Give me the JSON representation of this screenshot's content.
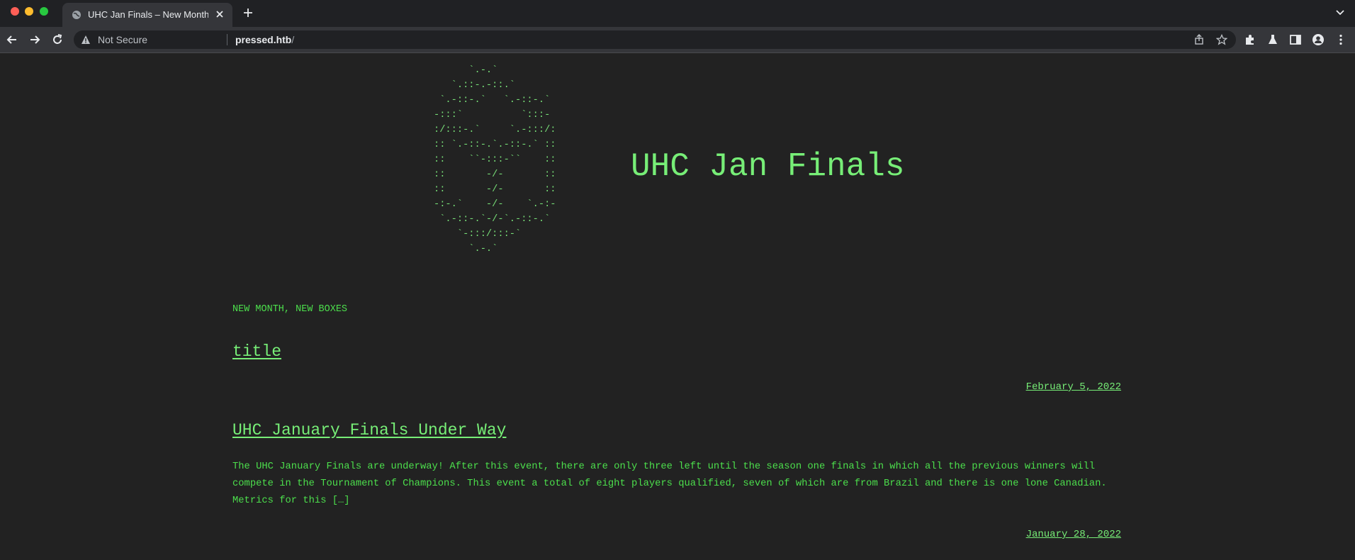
{
  "browser": {
    "tab_title": "UHC Jan Finals – New Month, New Boxes",
    "security_label": "Not Secure",
    "url_host": "pressed.htb",
    "url_path": "/"
  },
  "site": {
    "ascii_logo": "      `.-.`\n   `.::-.-::.`\n `.-::-.`   `.-::-.`\n-:::`          `:::-\n:/:::-.`     `.-:::/:\n:: `.-::-.`.-::-.` ::\n::    ``-:::-``    ::\n::       -/-       ::\n::       -/-       ::\n-:-.`    -/-    `.-:-\n `.-::-.`-/-`.-::-.`\n    `-:::/:::-`\n      `.-.`",
    "title": "UHC Jan Finals",
    "tagline": "NEW MONTH, NEW BOXES"
  },
  "posts": [
    {
      "title": "title",
      "date": "February 5, 2022",
      "excerpt": ""
    },
    {
      "title": "UHC January Finals Under Way",
      "excerpt": "The UHC January Finals are underway! After this event, there are only three left until the season one finals in which all the previous winners will compete in the Tournament of Champions. This event a total of eight players qualified, seven of which are from Brazil and there is one lone Canadian. Metrics for this […]",
      "date": "January 28, 2022"
    }
  ],
  "colors": {
    "page_bg": "#222222",
    "text_green": "#77ee77",
    "tagline_green": "#4cdf4c"
  }
}
